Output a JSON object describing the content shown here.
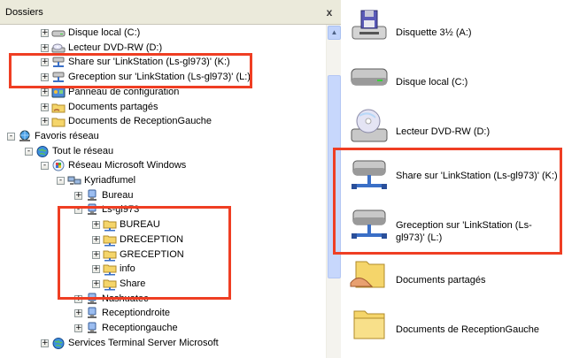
{
  "left_panel": {
    "title": "Dossiers",
    "close_label": "x",
    "tree": [
      {
        "label": "Disque local (C:)",
        "icon": "local-disk-icon",
        "level": 2,
        "expander": "+"
      },
      {
        "label": "Lecteur DVD-RW (D:)",
        "icon": "dvd-drive-icon",
        "level": 2,
        "expander": "+"
      },
      {
        "label": "Share sur 'LinkStation (Ls-gl973)' (K:)",
        "icon": "network-drive-icon",
        "level": 2,
        "expander": "+"
      },
      {
        "label": "Greception sur 'LinkStation (Ls-gl973)' (L:)",
        "icon": "network-drive-icon",
        "level": 2,
        "expander": "+"
      },
      {
        "label": "Panneau de configuration",
        "icon": "control-panel-icon",
        "level": 2,
        "expander": "+"
      },
      {
        "label": "Documents partagés",
        "icon": "shared-folder-icon",
        "level": 2,
        "expander": "+"
      },
      {
        "label": "Documents de ReceptionGauche",
        "icon": "folder-icon",
        "level": 2,
        "expander": "+"
      },
      {
        "label": "Favoris réseau",
        "icon": "network-places-icon",
        "level": 0,
        "expander": "-"
      },
      {
        "label": "Tout le réseau",
        "icon": "globe-icon",
        "level": 1,
        "expander": "-"
      },
      {
        "label": "Réseau Microsoft Windows",
        "icon": "windows-network-icon",
        "level": 2,
        "expander": "-"
      },
      {
        "label": "Kyriadfumel",
        "icon": "workgroup-icon",
        "level": 3,
        "expander": "-"
      },
      {
        "label": "Bureau",
        "icon": "computer-icon",
        "level": 4,
        "expander": "+"
      },
      {
        "label": "Ls-gl973",
        "icon": "computer-icon",
        "level": 4,
        "expander": "-"
      },
      {
        "label": "BUREAU",
        "icon": "network-share-icon",
        "level": 5,
        "expander": "+"
      },
      {
        "label": "DRECEPTION",
        "icon": "network-share-icon",
        "level": 5,
        "expander": "+"
      },
      {
        "label": "GRECEPTION",
        "icon": "network-share-icon",
        "level": 5,
        "expander": "+"
      },
      {
        "label": "info",
        "icon": "network-share-icon",
        "level": 5,
        "expander": "+"
      },
      {
        "label": "Share",
        "icon": "network-share-icon",
        "level": 5,
        "expander": "+"
      },
      {
        "label": "Nashuatec",
        "icon": "computer-icon",
        "level": 4,
        "expander": "+"
      },
      {
        "label": "Receptiondroite",
        "icon": "computer-icon",
        "level": 4,
        "expander": "+"
      },
      {
        "label": "Receptiongauche",
        "icon": "computer-icon",
        "level": 4,
        "expander": "+"
      },
      {
        "label": "Services Terminal Server Microsoft",
        "icon": "globe-icon",
        "level": 2,
        "expander": "+"
      }
    ]
  },
  "right_panel": {
    "items": [
      {
        "label": "Disquette 3½ (A:)",
        "icon": "floppy-drive-icon"
      },
      {
        "label": "Disque local (C:)",
        "icon": "local-disk-icon"
      },
      {
        "label": "Lecteur DVD-RW (D:)",
        "icon": "dvd-drive-icon"
      },
      {
        "label": "Share sur 'LinkStation (Ls-gl973)' (K:)",
        "icon": "network-drive-icon"
      },
      {
        "label": "Greception sur 'LinkStation (Ls-gl973)' (L:)",
        "icon": "network-drive-icon"
      },
      {
        "label": "Documents partagés",
        "icon": "shared-folder-icon"
      },
      {
        "label": "Documents de ReceptionGauche",
        "icon": "folder-icon"
      }
    ]
  },
  "colors": {
    "highlight": "#ef3e23",
    "header_bg": "#ebeadb",
    "scrollbar": "#c7d7fc"
  }
}
